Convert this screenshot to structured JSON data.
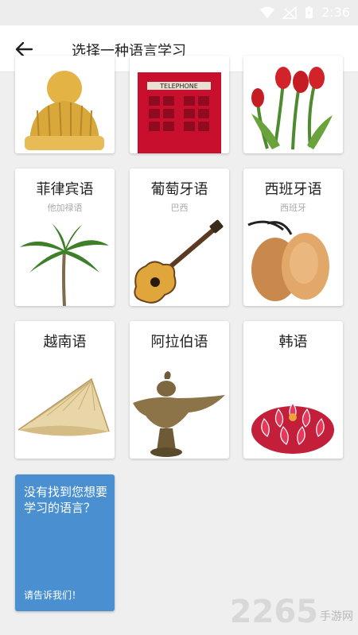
{
  "status_bar": {
    "time": "2:36"
  },
  "header": {
    "title": "选择一种语言学习",
    "back_icon": "arrow-left-icon"
  },
  "cards": [
    {
      "title": "",
      "subtitle": "",
      "art": "wool-hat"
    },
    {
      "title": "",
      "subtitle": "",
      "art": "phone-booth",
      "booth_sign": "TELEPHONE"
    },
    {
      "title": "",
      "subtitle": "",
      "art": "tulips"
    },
    {
      "title": "菲律宾语",
      "subtitle": "他加禄语",
      "art": "palm-tree"
    },
    {
      "title": "葡萄牙语",
      "subtitle": "巴西",
      "art": "guitar"
    },
    {
      "title": "西班牙语",
      "subtitle": "西班牙",
      "art": "castanets"
    },
    {
      "title": "越南语",
      "subtitle": "",
      "art": "conical-hat"
    },
    {
      "title": "阿拉伯语",
      "subtitle": "",
      "art": "oil-lamp"
    },
    {
      "title": "韩语",
      "subtitle": "",
      "art": "lotus-flower"
    }
  ],
  "help_card": {
    "text": "没有找到您想要学习的语言？",
    "link": "请告诉我们！"
  },
  "watermark": {
    "number": "2265",
    "text": "手游网"
  }
}
